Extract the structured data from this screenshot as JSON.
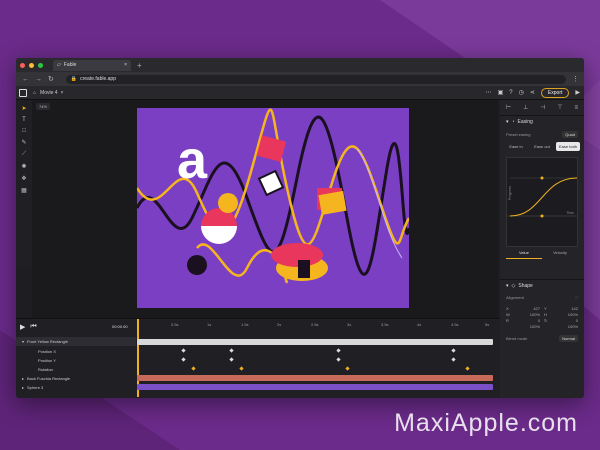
{
  "browser": {
    "tab_title": "Fable",
    "url": "create.fable.app"
  },
  "app": {
    "file_tab": "Movie 4",
    "export_label": "Export",
    "zoom": "74%"
  },
  "canvas": {
    "glyph": "a",
    "bg": "#7b3fc4",
    "accent_yellow": "#f5b51f",
    "accent_pink": "#e8365c"
  },
  "panel": {
    "easing": {
      "title": "Easing",
      "preset_label": "Preset easing",
      "preset_value": "Quad",
      "buttons": [
        "Ease in",
        "Ease out",
        "Ease both"
      ],
      "graph_y_label": "Progress",
      "graph_x_label": "Time",
      "tabs": [
        "Value",
        "Velocity"
      ]
    },
    "shape": {
      "title": "Shape",
      "align_label": "Alignment",
      "fields": [
        [
          "X",
          "427"
        ],
        [
          "Y",
          "142"
        ],
        [
          "W",
          "100%"
        ],
        [
          "H",
          "100%"
        ],
        [
          "R",
          "0"
        ],
        [
          "↻",
          "0"
        ],
        [
          "",
          "100%"
        ],
        [
          "",
          "100%"
        ]
      ],
      "blend_label": "Blend mode",
      "blend_value": "Normal"
    }
  },
  "timeline": {
    "time": "00:00.00",
    "ruler": [
      "0.5s",
      "1s",
      "1.5s",
      "2s",
      "2.5s",
      "3s",
      "3.5s",
      "4s",
      "4.5s",
      "5s"
    ],
    "layers": [
      "Front Yellow Rectangle",
      "Position X",
      "Position Y",
      "Rotation",
      "Back Fuschia Rectangle",
      "Sphere 3"
    ]
  },
  "watermark": "MaxiApple.com"
}
